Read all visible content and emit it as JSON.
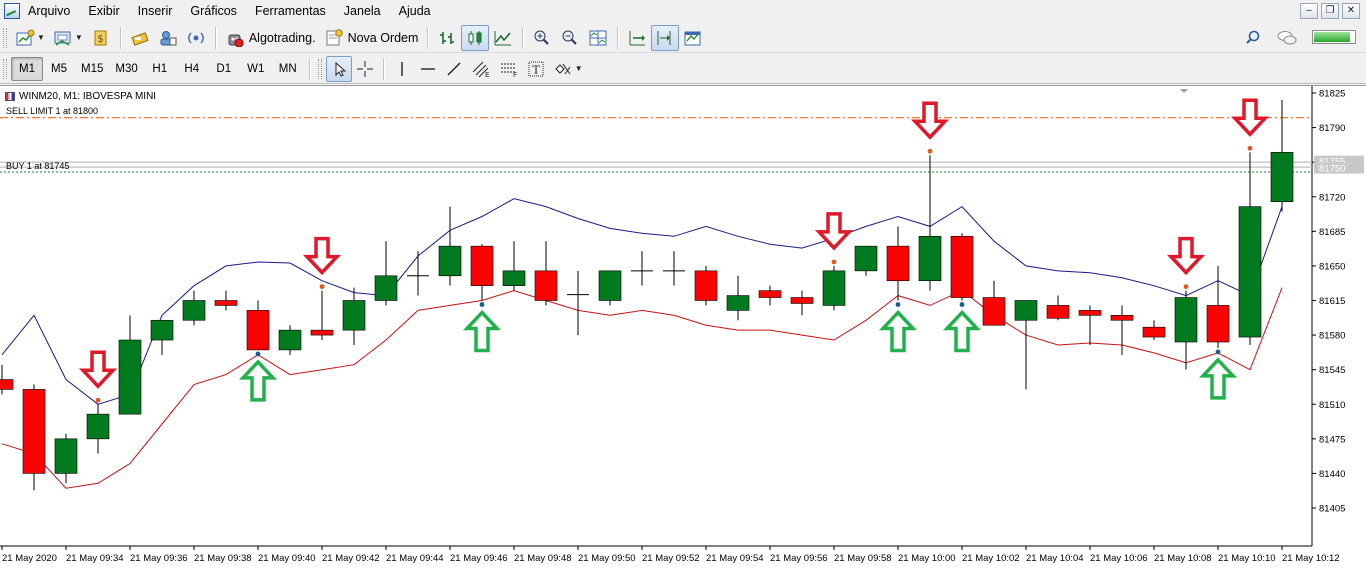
{
  "menu": {
    "items": [
      "Arquivo",
      "Exibir",
      "Inserir",
      "Gráficos",
      "Ferramentas",
      "Janela",
      "Ajuda"
    ]
  },
  "toolbar": {
    "algotrading_label": "Algotrading.",
    "new_order_label": "Nova Ordem",
    "connection_level": 0.85
  },
  "timeframes": {
    "items": [
      "M1",
      "M5",
      "M15",
      "M30",
      "H1",
      "H4",
      "D1",
      "W1",
      "MN"
    ],
    "active": "M1"
  },
  "chart": {
    "header": "WINM20, M1:  IBOVESPA MINI",
    "sell_limit_label": "SELL LIMIT 1 at 81800",
    "buy_label": "BUY 1 at 81745",
    "colors": {
      "bull": "#007a1e",
      "bear": "#ff0000",
      "upper_band": "#1a1a8a",
      "lower_band": "#cc1111",
      "arrow_down": "#e0182a",
      "arrow_up": "#22b14c",
      "sell_line": "#f06a1a",
      "buy_line": "#1a8a2a"
    }
  },
  "chart_data": {
    "type": "candlestick",
    "ylim": [
      81380,
      81830
    ],
    "y_ticks": [
      81825,
      81790,
      81755,
      81720,
      81685,
      81650,
      81615,
      81580,
      81545,
      81510,
      81475,
      81440,
      81405
    ],
    "price_labels": [
      "81755",
      "81750"
    ],
    "x_labels": [
      "21 May 2020",
      "21 May 09:34",
      "21 May 09:36",
      "21 May 09:38",
      "21 May 09:40",
      "21 May 09:42",
      "21 May 09:44",
      "21 May 09:46",
      "21 May 09:48",
      "21 May 09:50",
      "21 May 09:52",
      "21 May 09:54",
      "21 May 09:56",
      "21 May 09:58",
      "21 May 10:00",
      "21 May 10:02",
      "21 May 10:04",
      "21 May 10:06",
      "21 May 10:08",
      "21 May 10:10",
      "21 May 10:12"
    ],
    "reference_lines": {
      "sell_limit": 81800,
      "buy": 81745,
      "grey": [
        81755,
        81750
      ]
    },
    "candles": [
      {
        "o": 81535,
        "h": 81550,
        "l": 81520,
        "c": 81525
      },
      {
        "o": 81525,
        "h": 81530,
        "l": 81423,
        "c": 81440
      },
      {
        "o": 81440,
        "h": 81480,
        "l": 81430,
        "c": 81475
      },
      {
        "o": 81475,
        "h": 81510,
        "l": 81460,
        "c": 81500
      },
      {
        "o": 81500,
        "h": 81600,
        "l": 81500,
        "c": 81575
      },
      {
        "o": 81575,
        "h": 81595,
        "l": 81560,
        "c": 81595
      },
      {
        "o": 81595,
        "h": 81625,
        "l": 81590,
        "c": 81615
      },
      {
        "o": 81615,
        "h": 81625,
        "l": 81605,
        "c": 81610
      },
      {
        "o": 81605,
        "h": 81615,
        "l": 81565,
        "c": 81565
      },
      {
        "o": 81565,
        "h": 81590,
        "l": 81560,
        "c": 81585
      },
      {
        "o": 81585,
        "h": 81625,
        "l": 81575,
        "c": 81580
      },
      {
        "o": 81585,
        "h": 81628,
        "l": 81570,
        "c": 81615
      },
      {
        "o": 81615,
        "h": 81675,
        "l": 81610,
        "c": 81640
      },
      {
        "o": 81640,
        "h": 81665,
        "l": 81620,
        "c": 81640
      },
      {
        "o": 81640,
        "h": 81710,
        "l": 81630,
        "c": 81670
      },
      {
        "o": 81670,
        "h": 81672,
        "l": 81615,
        "c": 81630
      },
      {
        "o": 81630,
        "h": 81675,
        "l": 81625,
        "c": 81645
      },
      {
        "o": 81645,
        "h": 81675,
        "l": 81610,
        "c": 81615
      },
      {
        "o": 81620,
        "h": 81645,
        "l": 81580,
        "c": 81621
      },
      {
        "o": 81615,
        "h": 81645,
        "l": 81610,
        "c": 81645
      },
      {
        "o": 81645,
        "h": 81665,
        "l": 81630,
        "c": 81645
      },
      {
        "o": 81645,
        "h": 81665,
        "l": 81630,
        "c": 81645
      },
      {
        "o": 81645,
        "h": 81650,
        "l": 81610,
        "c": 81615
      },
      {
        "o": 81605,
        "h": 81640,
        "l": 81595,
        "c": 81620
      },
      {
        "o": 81625,
        "h": 81630,
        "l": 81610,
        "c": 81618
      },
      {
        "o": 81618,
        "h": 81625,
        "l": 81600,
        "c": 81612
      },
      {
        "o": 81610,
        "h": 81650,
        "l": 81605,
        "c": 81645
      },
      {
        "o": 81645,
        "h": 81670,
        "l": 81640,
        "c": 81670
      },
      {
        "o": 81670,
        "h": 81690,
        "l": 81615,
        "c": 81635
      },
      {
        "o": 81635,
        "h": 81762,
        "l": 81625,
        "c": 81680
      },
      {
        "o": 81680,
        "h": 81683,
        "l": 81615,
        "c": 81618
      },
      {
        "o": 81618,
        "h": 81635,
        "l": 81590,
        "c": 81590
      },
      {
        "o": 81595,
        "h": 81615,
        "l": 81525,
        "c": 81615
      },
      {
        "o": 81610,
        "h": 81620,
        "l": 81595,
        "c": 81597
      },
      {
        "o": 81605,
        "h": 81610,
        "l": 81570,
        "c": 81600
      },
      {
        "o": 81600,
        "h": 81610,
        "l": 81560,
        "c": 81595
      },
      {
        "o": 81588,
        "h": 81595,
        "l": 81575,
        "c": 81578
      },
      {
        "o": 81573,
        "h": 81625,
        "l": 81545,
        "c": 81618
      },
      {
        "o": 81610,
        "h": 81650,
        "l": 81567,
        "c": 81573
      },
      {
        "o": 81578,
        "h": 81765,
        "l": 81570,
        "c": 81710
      },
      {
        "o": 81715,
        "h": 81818,
        "l": 81705,
        "c": 81765
      }
    ],
    "upper_band": [
      81560,
      81600,
      81535,
      81510,
      81520,
      81600,
      81630,
      81650,
      81654,
      81653,
      81635,
      81623,
      81620,
      81660,
      81686,
      81700,
      81718,
      81710,
      81698,
      81688,
      81683,
      81680,
      81690,
      81680,
      81672,
      81668,
      81678,
      81690,
      81700,
      81690,
      81710,
      81675,
      81650,
      81645,
      81643,
      81638,
      81630,
      81620,
      81635,
      81620,
      81710
    ],
    "lower_band": [
      81470,
      81460,
      81425,
      81430,
      81450,
      81490,
      81530,
      81540,
      81560,
      81540,
      81545,
      81550,
      81575,
      81605,
      81610,
      81615,
      81625,
      81615,
      81605,
      81600,
      81605,
      81600,
      81590,
      81585,
      81585,
      81580,
      81575,
      81595,
      81620,
      81610,
      81625,
      81600,
      81580,
      81570,
      81572,
      81570,
      81562,
      81552,
      81562,
      81545,
      81628
    ],
    "sell_signals": [
      3,
      10,
      26,
      29,
      37,
      39
    ],
    "buy_signals": [
      8,
      15,
      28,
      30,
      38
    ]
  }
}
